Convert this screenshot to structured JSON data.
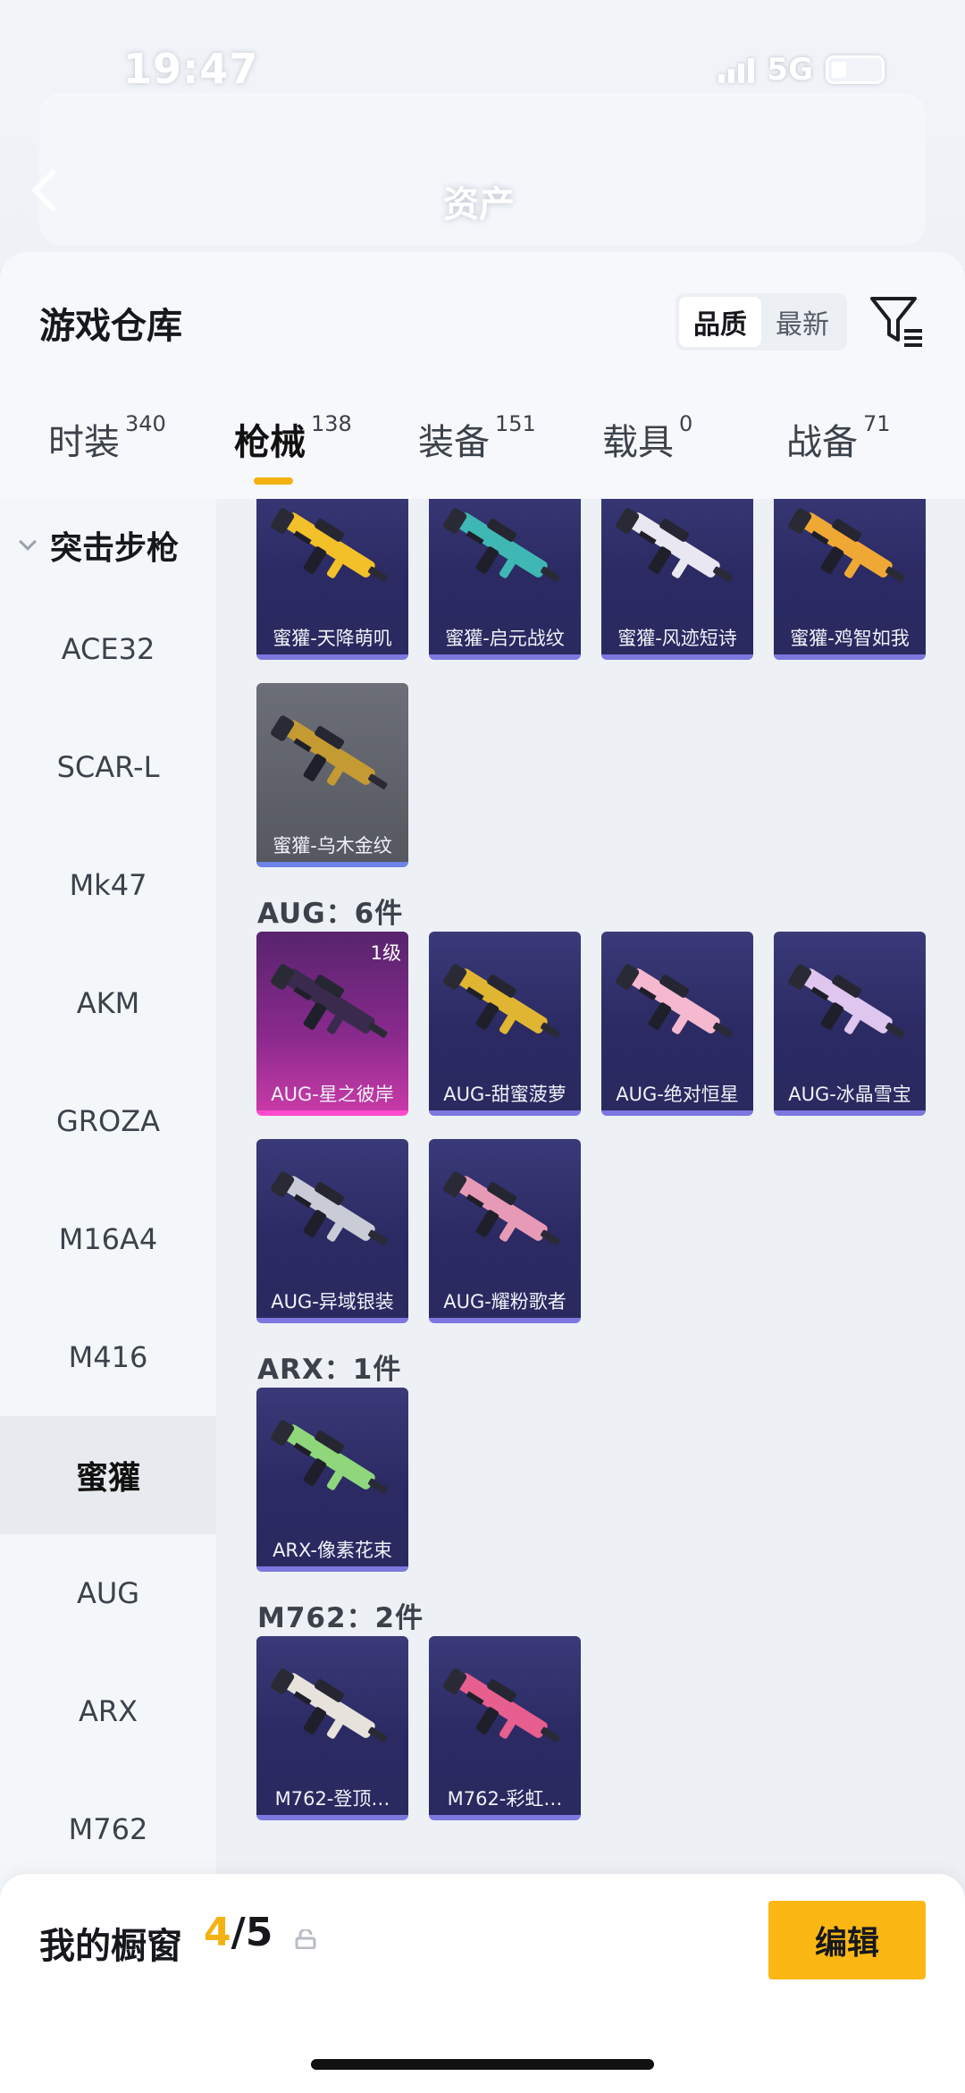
{
  "status_bar": {
    "time": "19:47",
    "network": "5G"
  },
  "background_header": {
    "title": "资产"
  },
  "sheet": {
    "title": "游戏仓库",
    "sort_options": [
      {
        "label": "品质",
        "active": true
      },
      {
        "label": "最新",
        "active": false
      }
    ],
    "filter_icon": "filter-icon"
  },
  "tabs": [
    {
      "label": "时装",
      "count": "340",
      "active": false
    },
    {
      "label": "枪械",
      "count": "138",
      "active": true
    },
    {
      "label": "装备",
      "count": "151",
      "active": false
    },
    {
      "label": "载具",
      "count": "0",
      "active": false
    },
    {
      "label": "战备",
      "count": "71",
      "active": false
    }
  ],
  "categories": {
    "group_label": "突击步枪",
    "items": [
      {
        "label": "ACE32",
        "active": false
      },
      {
        "label": "SCAR-L",
        "active": false
      },
      {
        "label": "Mk47",
        "active": false
      },
      {
        "label": "AKM",
        "active": false
      },
      {
        "label": "GROZA",
        "active": false
      },
      {
        "label": "M16A4",
        "active": false
      },
      {
        "label": "M416",
        "active": false
      },
      {
        "label": "蜜獾",
        "active": true
      },
      {
        "label": "AUG",
        "active": false
      },
      {
        "label": "ARX",
        "active": false
      },
      {
        "label": "M762",
        "active": false
      }
    ]
  },
  "groups": [
    {
      "title": "",
      "items": [
        {
          "name": "蜜獾-天降萌叽",
          "style": "purple",
          "gun_color": "#f2c029"
        },
        {
          "name": "蜜獾-启元战纹",
          "style": "purple",
          "gun_color": "#3fb7b4"
        },
        {
          "name": "蜜獾-风迹短诗",
          "style": "purple",
          "gun_color": "#e9e7f2"
        },
        {
          "name": "蜜獾-鸡智如我",
          "style": "purple",
          "gun_color": "#f0a835"
        },
        {
          "name": "蜜獾-乌木金纹",
          "style": "gray",
          "gun_color": "#c49a33"
        }
      ]
    },
    {
      "title": "AUG：6件",
      "items": [
        {
          "name": "AUG-星之彼岸",
          "style": "pink",
          "gun_color": "#3a2a4e",
          "level": "1级"
        },
        {
          "name": "AUG-甜蜜菠萝",
          "style": "purple",
          "gun_color": "#e0b532"
        },
        {
          "name": "AUG-绝对恒星",
          "style": "purple",
          "gun_color": "#f4b8cf"
        },
        {
          "name": "AUG-冰晶雪宝",
          "style": "purple",
          "gun_color": "#dfc6ee"
        },
        {
          "name": "AUG-异域银装",
          "style": "purple",
          "gun_color": "#c9ccd6"
        },
        {
          "name": "AUG-耀粉歌者",
          "style": "purple",
          "gun_color": "#e79ab6"
        }
      ]
    },
    {
      "title": "ARX：1件",
      "items": [
        {
          "name": "ARX-像素花束",
          "style": "purple",
          "gun_color": "#8fd67c"
        }
      ]
    },
    {
      "title": "M762：2件",
      "items": [
        {
          "name": "M762-登顶…",
          "style": "purple",
          "gun_color": "#e7e3dc"
        },
        {
          "name": "M762-彩虹…",
          "style": "purple",
          "gun_color": "#e75f8f"
        }
      ]
    }
  ],
  "bottom_bar": {
    "label": "我的橱窗",
    "current": "4",
    "total": "/5",
    "edit_label": "编辑"
  },
  "colors": {
    "accent": "#fbb714",
    "tab_indicator": "#f3b211"
  }
}
